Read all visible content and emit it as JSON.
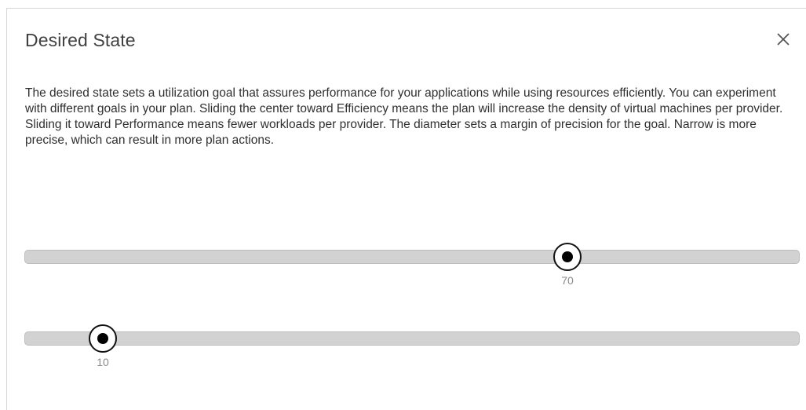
{
  "dialog": {
    "title": "Desired State",
    "close_icon": "close-icon",
    "description": "The desired state sets a utilization goal that assures performance for your applications while using resources efficiently. You can experiment with different goals in your plan. Sliding the center toward Efficiency means the plan will increase the density of virtual machines per provider. Sliding it toward Performance means fewer workloads per provider. The diameter sets a margin of precision for the goal. Narrow is more precise, which can result in more plan actions."
  },
  "sliders": {
    "center": {
      "value": "70",
      "min": 0,
      "max": 100
    },
    "diameter": {
      "value": "10",
      "min": 0,
      "max": 100
    }
  },
  "colors": {
    "track": "#d2d2d2",
    "thumb_border": "#111111",
    "value_text": "#8a8a8a",
    "title_text": "#404040"
  }
}
